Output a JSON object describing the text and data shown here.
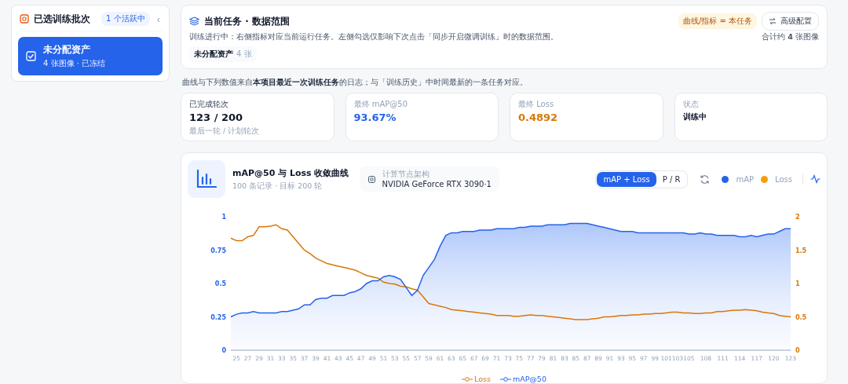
{
  "sidebar": {
    "title": "已选训练批次",
    "badge": "1 个活跃中",
    "collapse_icon": "‹",
    "batches": [
      {
        "name": "未分配资产",
        "meta": "4 张图像 · 已冻结",
        "selected": true,
        "checked": true
      }
    ]
  },
  "task": {
    "title": "当前任务 · 数据范围",
    "tag": "曲线/指标 = 本任务",
    "config_button": "高级配置",
    "description": "训练进行中：右侧指标对应当前运行任务。左侧勾选仅影响下次点击「同步开启微调训练」时的数据范围。",
    "total": "合计约 **4** 张图像",
    "chip_name": "未分配资产",
    "chip_count": "4 张"
  },
  "source_note": "曲线与下列数值来自**本项目最近一次训练任务**的日志；与「训练历史」中时间最新的一条任务对应。",
  "stats": [
    {
      "label": "已完成轮次",
      "value": "123 / 200",
      "sub": "最后一轮 / 计划轮次",
      "kind": "plain"
    },
    {
      "label": "最终 mAP@50",
      "value": "93.67%",
      "kind": "map"
    },
    {
      "label": "最终 Loss",
      "value": "0.4892",
      "kind": "loss"
    },
    {
      "label": "状态",
      "value": "训练中",
      "kind": "status"
    }
  ],
  "chart_card": {
    "title": "mAP@50 与 Loss 收敛曲线",
    "subtitle": "100 条记录 · 目标 200 轮",
    "node_label": "计算节点架构",
    "node_value": "NVIDIA GeForce RTX 3090·1",
    "toggle": [
      {
        "label": "mAP + Loss",
        "selected": true
      },
      {
        "label": "P / R",
        "selected": false
      }
    ],
    "legend_top": [
      {
        "label": "mAP",
        "color": "#2563eb"
      },
      {
        "label": "Loss",
        "color": "#f59e0b"
      }
    ],
    "chart_data": {
      "type": "area",
      "x": [
        24,
        25,
        26,
        27,
        28,
        29,
        30,
        31,
        32,
        33,
        34,
        35,
        36,
        37,
        38,
        39,
        40,
        41,
        42,
        43,
        44,
        45,
        46,
        47,
        48,
        49,
        50,
        51,
        52,
        53,
        54,
        55,
        56,
        57,
        58,
        59,
        60,
        61,
        62,
        63,
        64,
        65,
        66,
        67,
        68,
        69,
        70,
        71,
        72,
        73,
        74,
        75,
        76,
        77,
        78,
        79,
        80,
        81,
        82,
        83,
        84,
        85,
        86,
        87,
        88,
        89,
        90,
        91,
        92,
        93,
        94,
        95,
        96,
        97,
        98,
        99,
        100,
        101,
        102,
        103,
        104,
        105,
        106,
        107,
        108,
        109,
        110,
        111,
        112,
        113,
        114,
        115,
        116,
        117,
        118,
        119,
        120,
        121,
        122,
        123
      ],
      "legend": "bottom",
      "xlim": [
        24,
        123
      ],
      "ylim": [
        0,
        1
      ],
      "yticks": [
        0,
        0.25,
        0.5,
        0.75,
        1
      ],
      "y2lim": [
        0,
        2
      ],
      "y2ticks": [
        0,
        0.5,
        1,
        1.5,
        2
      ],
      "xticks": [
        25,
        27,
        29,
        31,
        33,
        35,
        37,
        39,
        41,
        43,
        45,
        47,
        49,
        51,
        53,
        55,
        57,
        59,
        61,
        63,
        65,
        67,
        69,
        71,
        73,
        75,
        77,
        79,
        81,
        83,
        85,
        87,
        89,
        91,
        93,
        95,
        97,
        99,
        101,
        103,
        105,
        108,
        111,
        114,
        117,
        120,
        123
      ],
      "series": [
        {
          "name": "Loss",
          "color": "#d97706",
          "axis": "y2",
          "type": "line",
          "values": [
            1.68,
            1.64,
            1.64,
            1.7,
            1.72,
            1.85,
            1.85,
            1.86,
            1.88,
            1.82,
            1.8,
            1.7,
            1.6,
            1.5,
            1.45,
            1.38,
            1.34,
            1.3,
            1.28,
            1.26,
            1.24,
            1.22,
            1.2,
            1.16,
            1.12,
            1.1,
            1.08,
            1.02,
            1.0,
            0.99,
            0.96,
            0.95,
            0.92,
            0.9,
            0.8,
            0.7,
            0.68,
            0.66,
            0.64,
            0.61,
            0.6,
            0.59,
            0.58,
            0.57,
            0.56,
            0.55,
            0.54,
            0.52,
            0.52,
            0.52,
            0.51,
            0.51,
            0.52,
            0.53,
            0.52,
            0.52,
            0.51,
            0.5,
            0.49,
            0.48,
            0.47,
            0.46,
            0.46,
            0.46,
            0.47,
            0.48,
            0.5,
            0.5,
            0.51,
            0.52,
            0.52,
            0.53,
            0.53,
            0.54,
            0.54,
            0.55,
            0.55,
            0.56,
            0.57,
            0.57,
            0.56,
            0.56,
            0.55,
            0.55,
            0.56,
            0.56,
            0.58,
            0.58,
            0.59,
            0.6,
            0.6,
            0.61,
            0.6,
            0.59,
            0.57,
            0.56,
            0.55,
            0.52,
            0.51,
            0.5
          ]
        },
        {
          "name": "mAP@50",
          "color": "#2563eb",
          "type": "area",
          "values": [
            0.25,
            0.27,
            0.28,
            0.28,
            0.29,
            0.28,
            0.28,
            0.28,
            0.28,
            0.29,
            0.29,
            0.3,
            0.31,
            0.34,
            0.34,
            0.38,
            0.39,
            0.39,
            0.41,
            0.41,
            0.41,
            0.43,
            0.44,
            0.46,
            0.5,
            0.52,
            0.52,
            0.55,
            0.56,
            0.55,
            0.53,
            0.47,
            0.41,
            0.45,
            0.56,
            0.62,
            0.68,
            0.78,
            0.86,
            0.88,
            0.88,
            0.89,
            0.89,
            0.89,
            0.9,
            0.9,
            0.9,
            0.91,
            0.91,
            0.91,
            0.91,
            0.92,
            0.92,
            0.93,
            0.93,
            0.93,
            0.94,
            0.94,
            0.94,
            0.94,
            0.95,
            0.95,
            0.95,
            0.95,
            0.94,
            0.93,
            0.92,
            0.91,
            0.9,
            0.89,
            0.89,
            0.89,
            0.88,
            0.88,
            0.88,
            0.88,
            0.88,
            0.88,
            0.88,
            0.88,
            0.88,
            0.87,
            0.87,
            0.88,
            0.87,
            0.87,
            0.86,
            0.86,
            0.86,
            0.86,
            0.85,
            0.85,
            0.86,
            0.85,
            0.86,
            0.87,
            0.87,
            0.89,
            0.91,
            0.91
          ]
        }
      ]
    }
  }
}
